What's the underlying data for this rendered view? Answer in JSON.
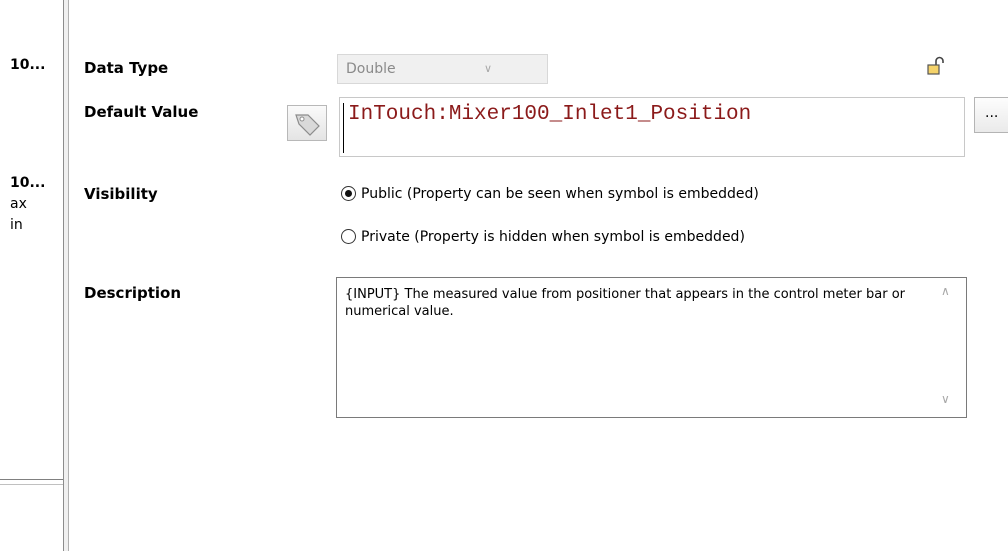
{
  "left_panel": {
    "items": [
      {
        "text": "10...",
        "bold": true
      },
      {
        "text": "10...",
        "bold": true
      },
      {
        "text": "ax",
        "bold": false
      },
      {
        "text": "in",
        "bold": false
      }
    ]
  },
  "properties": {
    "data_type": {
      "label": "Data Type",
      "value": "Double"
    },
    "default_value": {
      "label": "Default Value",
      "value": "InTouch:Mixer100_Inlet1_Position",
      "browse_label": "..."
    },
    "visibility": {
      "label": "Visibility",
      "options": [
        {
          "label": "Public (Property can be seen when symbol is embedded)",
          "selected": true
        },
        {
          "label": "Private (Property is hidden when symbol is embedded)",
          "selected": false
        }
      ]
    },
    "description": {
      "label": "Description",
      "value": "{INPUT} The measured value from positioner that appears in the control meter bar or numerical value."
    }
  },
  "icons": {
    "lock": "unlock-icon",
    "tag": "tag-browse-icon"
  },
  "colors": {
    "default_value_text": "#8b1a1a",
    "disabled_text": "#8a8a8a"
  }
}
